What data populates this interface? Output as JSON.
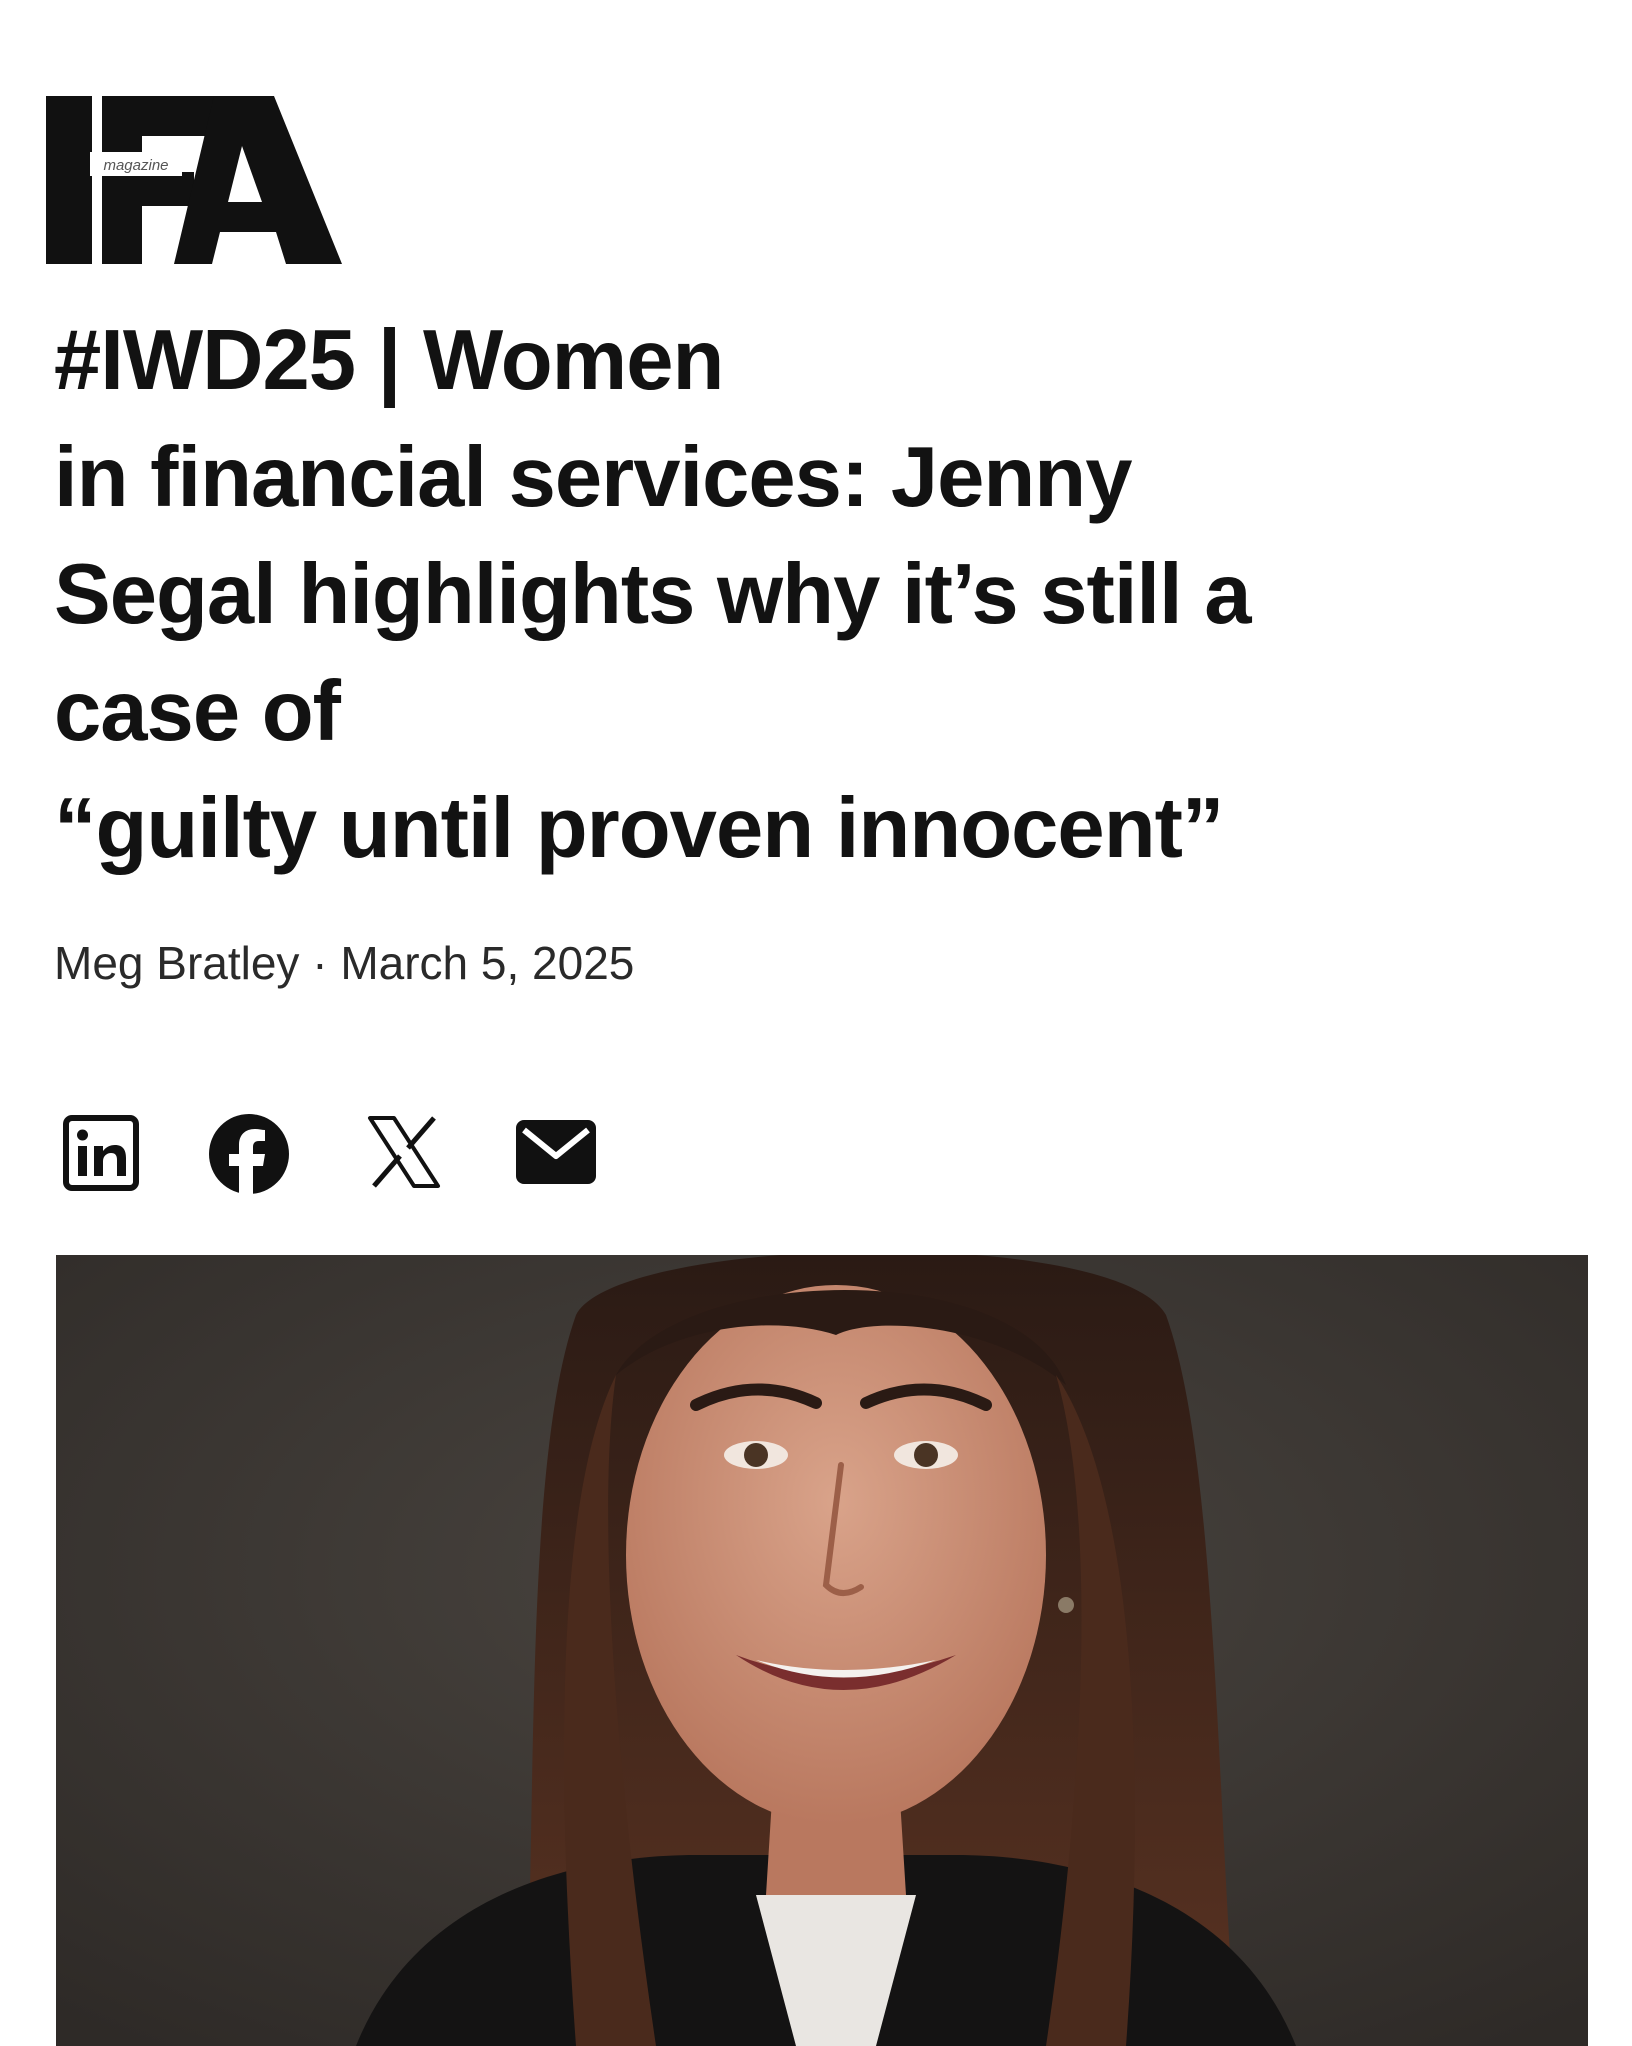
{
  "brand": {
    "logo_text": "IFA",
    "logo_subtext": "magazine",
    "logo_color": "#111111"
  },
  "article": {
    "headline_lines": [
      "#IWD25 | Women",
      "in financial services: Jenny",
      "Segal highlights why it’s still a",
      "case of",
      "“guilty until proven innocent”"
    ],
    "author": "Meg Bratley",
    "separator": "·",
    "date": "March 5, 2025"
  },
  "share": [
    {
      "icon": "linkedin-icon",
      "label": "in"
    },
    {
      "icon": "facebook-icon",
      "label": "f"
    },
    {
      "icon": "x-icon",
      "label": "X"
    },
    {
      "icon": "email-icon"
    }
  ],
  "hero_image": {
    "subject": "portrait photo",
    "background_color": "#3b3733"
  }
}
